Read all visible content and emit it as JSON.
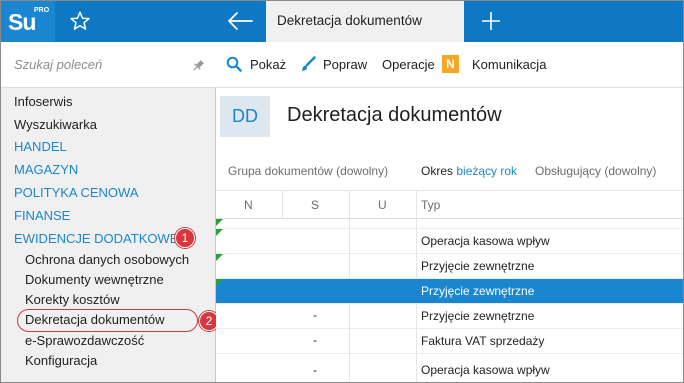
{
  "app": {
    "logo_text": "Su",
    "logo_sup": "PRO"
  },
  "sidebar": {
    "search_placeholder": "Szukaj poleceń",
    "items": [
      {
        "label": "Infoserwis",
        "type": "item"
      },
      {
        "label": "Wyszukiwarka",
        "type": "item"
      },
      {
        "label": "HANDEL",
        "type": "section"
      },
      {
        "label": "MAGAZYN",
        "type": "section"
      },
      {
        "label": "POLITYKA CENOWA",
        "type": "section"
      },
      {
        "label": "FINANSE",
        "type": "section"
      },
      {
        "label": "EWIDENCJE DODATKOWE",
        "type": "section"
      },
      {
        "label": "Ochrona danych osobowych",
        "type": "sub"
      },
      {
        "label": "Dokumenty wewnętrzne",
        "type": "sub"
      },
      {
        "label": "Korekty kosztów",
        "type": "sub"
      },
      {
        "label": "Dekretacja dokumentów",
        "type": "sub"
      },
      {
        "label": "e-Sprawozdawczość",
        "type": "sub"
      },
      {
        "label": "Konfiguracja",
        "type": "sub"
      }
    ],
    "badges": [
      "1",
      "2"
    ]
  },
  "topbar": {
    "active_tab": "Dekretacja dokumentów"
  },
  "toolbar": {
    "show": "Pokaż",
    "fix": "Popraw",
    "operations": "Operacje",
    "operations_badge": "N",
    "communication": "Komunikacja"
  },
  "title": {
    "badge": "DD",
    "text": "Dekretacja dokumentów"
  },
  "filters": {
    "group": "Grupa dokumentów",
    "group_value": "(dowolny)",
    "period": "Okres",
    "period_value": "bieżący rok",
    "handler": "Obsługujący",
    "handler_value": "(dowolny)"
  },
  "table": {
    "headers": [
      "N",
      "S",
      "U",
      "Typ"
    ],
    "rows": [
      {
        "n": "",
        "s": "",
        "u": "",
        "typ": "",
        "mark": true
      },
      {
        "n": "",
        "s": "",
        "u": "",
        "typ": "Operacja kasowa wpływ",
        "mark": true
      },
      {
        "n": "",
        "s": "",
        "u": "",
        "typ": "Przyjęcie zewnętrzne",
        "mark": true
      },
      {
        "n": "",
        "s": "",
        "u": "",
        "typ": "Przyjęcie zewnętrzne",
        "mark": true,
        "selected": true
      },
      {
        "n": "",
        "s": "-",
        "u": "",
        "typ": "Przyjęcie zewnętrzne",
        "mark": false
      },
      {
        "n": "",
        "s": "-",
        "u": "",
        "typ": "Faktura VAT sprzedaży",
        "mark": false
      },
      {
        "n": "",
        "s": "-",
        "u": "",
        "typ": "Operacja kasowa wpływ",
        "mark": false
      }
    ]
  },
  "colors": {
    "accent": "#1a86d0",
    "topbar": "#0e78c4",
    "badge_red": "#d9363e",
    "orange": "#f5a623"
  }
}
